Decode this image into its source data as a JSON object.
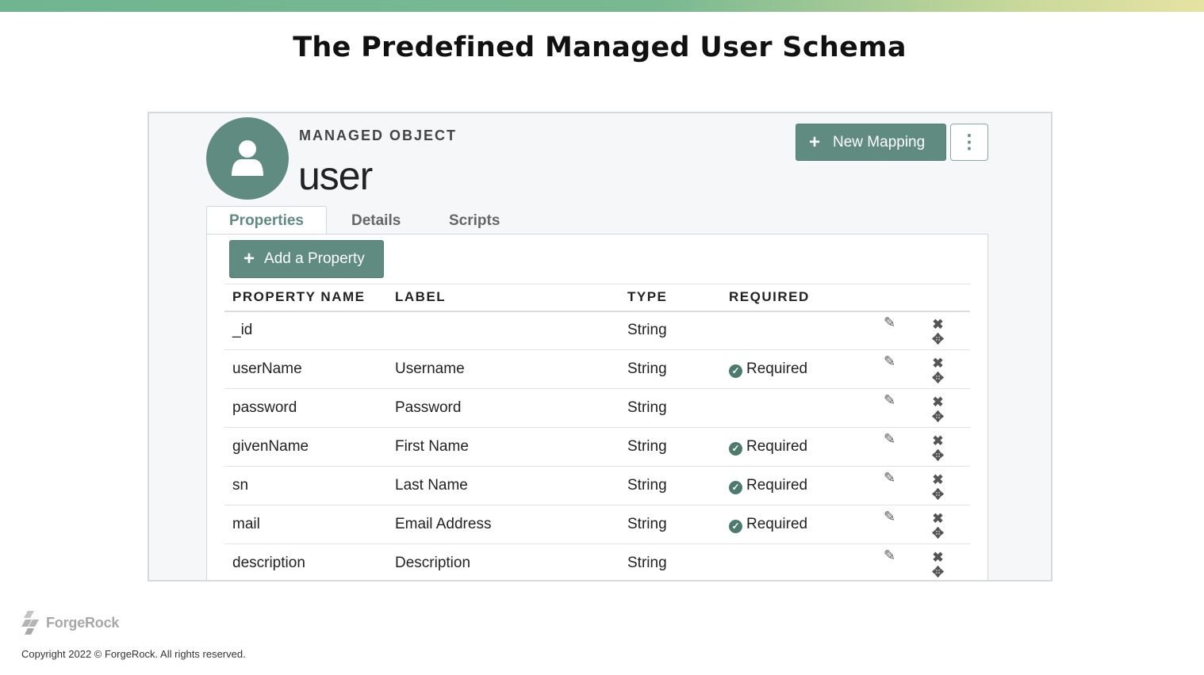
{
  "slide": {
    "title": "The Predefined Managed User Schema",
    "copyright": "Copyright 2022 © ForgeRock.  All rights reserved.",
    "brand": "ForgeRock"
  },
  "header": {
    "kicker": "MANAGED OBJECT",
    "object_name": "user",
    "avatar_icon": "user-icon",
    "new_mapping_label": "New Mapping",
    "more_icon": "kebab-menu-icon"
  },
  "tabs": [
    {
      "label": "Properties",
      "active": true
    },
    {
      "label": "Details",
      "active": false
    },
    {
      "label": "Scripts",
      "active": false
    }
  ],
  "toolbar": {
    "add_property_label": "Add a Property"
  },
  "table": {
    "headers": [
      "PROPERTY NAME",
      "LABEL",
      "TYPE",
      "REQUIRED"
    ],
    "rows": [
      {
        "name": "_id",
        "label": "",
        "type": "String",
        "required": ""
      },
      {
        "name": "userName",
        "label": "Username",
        "type": "String",
        "required": "Required"
      },
      {
        "name": "password",
        "label": "Password",
        "type": "String",
        "required": ""
      },
      {
        "name": "givenName",
        "label": "First Name",
        "type": "String",
        "required": "Required"
      },
      {
        "name": "sn",
        "label": "Last Name",
        "type": "String",
        "required": "Required"
      },
      {
        "name": "mail",
        "label": "Email Address",
        "type": "String",
        "required": "Required"
      },
      {
        "name": "description",
        "label": "Description",
        "type": "String",
        "required": ""
      }
    ]
  },
  "colors": {
    "accent": "#5f8b80",
    "required_green": "#4c7b6d"
  }
}
